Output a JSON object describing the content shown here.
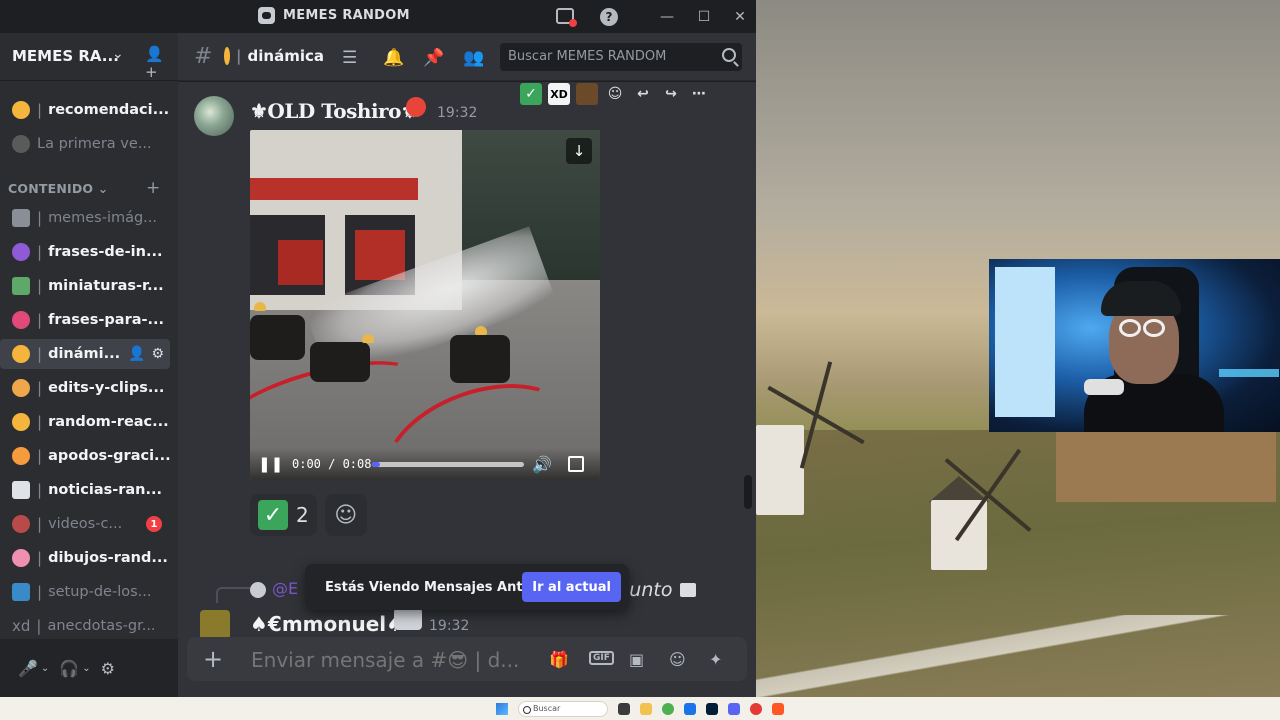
{
  "window": {
    "title": "MEMES RANDOM"
  },
  "server": {
    "name": "MEMES RA..."
  },
  "channels": [
    {
      "emoji_color": "#f5b53d",
      "name": "recomendaci...",
      "state": "unread"
    },
    {
      "emoji_color": "#5a5a5a",
      "name": "La primera ve...",
      "state": "muted"
    },
    {
      "emoji_color": "#8a8e96",
      "name": "memes-imág...",
      "state": "muted"
    },
    {
      "emoji_color": "#8e5ad6",
      "name": "frases-de-in...",
      "state": "unread"
    },
    {
      "emoji_color": "#5ea86a",
      "name": "miniaturas-r...",
      "state": "unread"
    },
    {
      "emoji_color": "#e14a78",
      "name": "frases-para-...",
      "state": "unread"
    },
    {
      "emoji_color": "#f5b53d",
      "name": "dinámi...",
      "state": "active"
    },
    {
      "emoji_color": "#f0a64b",
      "name": "edits-y-clips...",
      "state": "unread"
    },
    {
      "emoji_color": "#f5b53d",
      "name": "random-reac...",
      "state": "unread"
    },
    {
      "emoji_color": "#f59b3d",
      "name": "apodos-graci...",
      "state": "unread"
    },
    {
      "emoji_color": "#dfe3e8",
      "name": "noticias-ran...",
      "state": "unread"
    },
    {
      "emoji_color": "#b84a4a",
      "name": "videos-c...",
      "state": "muted",
      "badge": "1"
    },
    {
      "emoji_color": "#f090b0",
      "name": "dibujos-rand...",
      "state": "unread"
    },
    {
      "emoji_color": "#3a8ac9",
      "name": "setup-de-los...",
      "state": "muted"
    },
    {
      "emoji_text": "xd",
      "name": "anecdotas-gr...",
      "state": "muted"
    }
  ],
  "category": {
    "label": "CONTENIDO"
  },
  "header": {
    "channel_name": "dinámica",
    "search_placeholder": "Buscar MEMES RANDOM"
  },
  "message": {
    "author": "⚜OLD Toshiro⚜",
    "time": "19:32",
    "video": {
      "time_label": "0:00 / 0:08",
      "progress": 0.05
    },
    "reaction_count": "2",
    "hover_xd": "XD"
  },
  "reply": {
    "mention": "@E",
    "tail": "junto"
  },
  "message2": {
    "author": "♠€mmonuel♠",
    "time": "19:32"
  },
  "banner": {
    "text": "Estás Viendo Mensajes Antiguos",
    "button": "Ir al actual"
  },
  "composer": {
    "placeholder": "Enviar mensaje a #😎 | d..."
  },
  "taskbar": {
    "search": "Buscar"
  },
  "colors": {
    "accent": "#5865f2",
    "check": "#3ba55c",
    "badge": "#f23f43"
  }
}
